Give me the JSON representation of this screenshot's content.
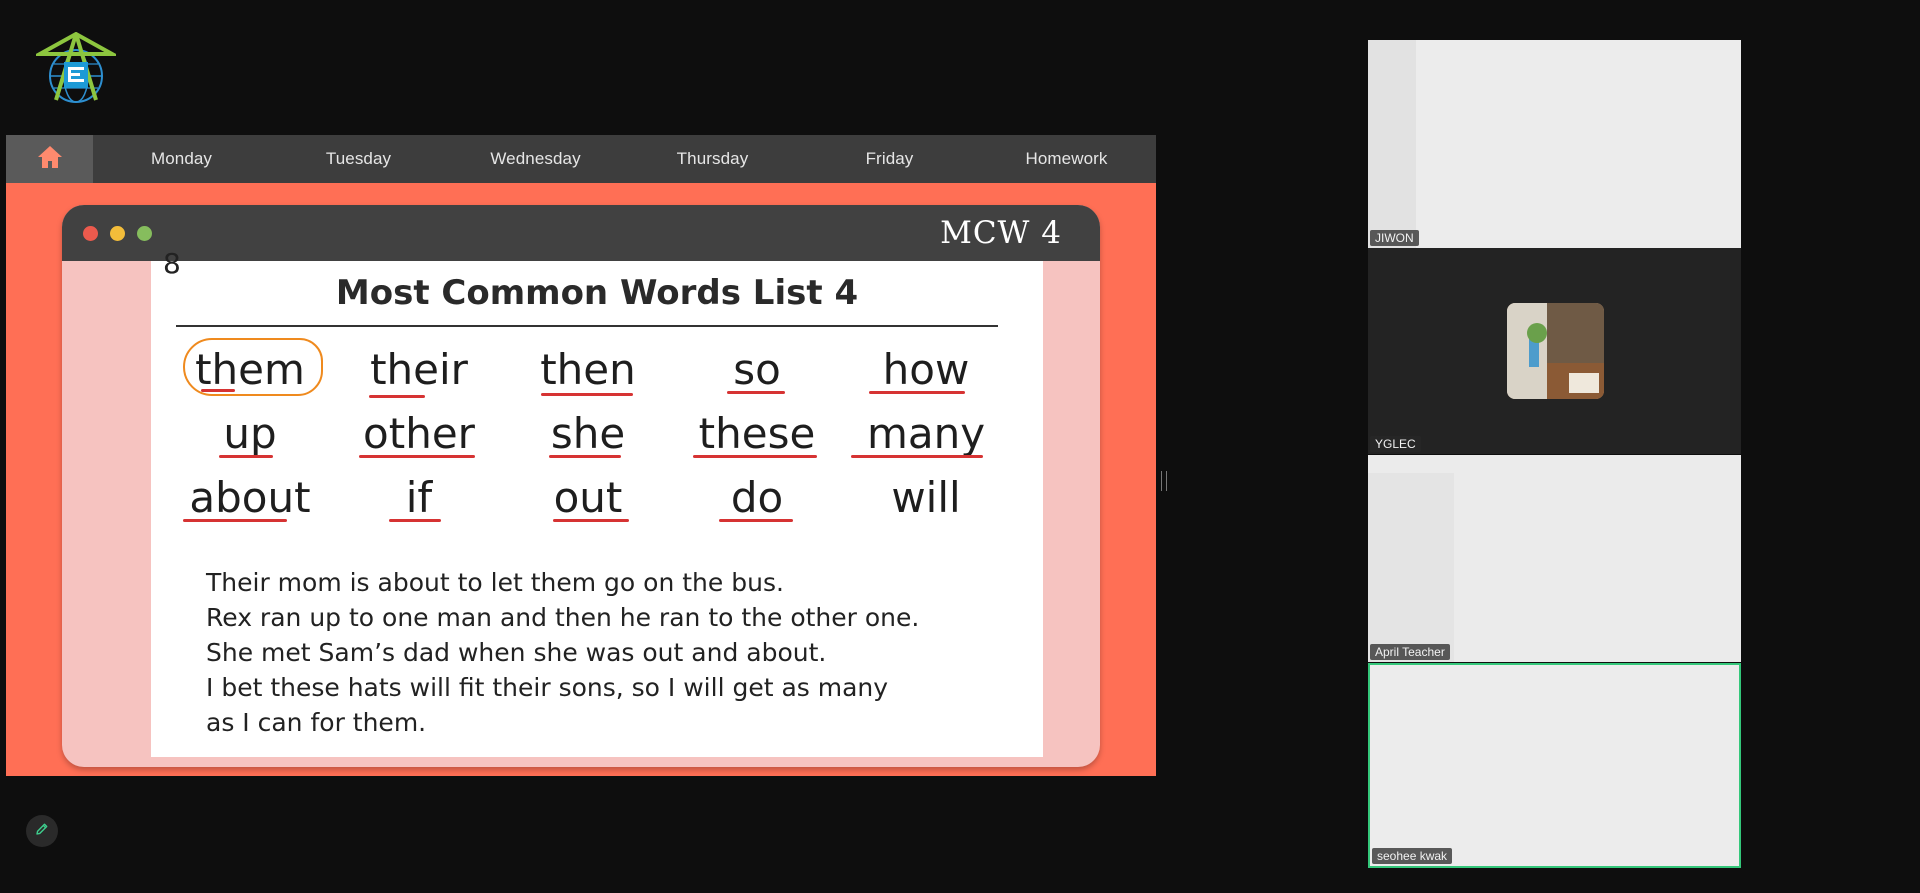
{
  "nav": {
    "items": [
      "Monday",
      "Tuesday",
      "Wednesday",
      "Thursday",
      "Friday",
      "Homework"
    ],
    "home_icon": "home-icon"
  },
  "window": {
    "title": "MCW 4"
  },
  "slide": {
    "corner_glyph": "8",
    "title": "Most Common Words List 4",
    "words": [
      [
        "them",
        "their",
        "then",
        "so",
        "how"
      ],
      [
        "up",
        "other",
        "she",
        "these",
        "many"
      ],
      [
        "about",
        "if",
        "out",
        "do",
        "will"
      ]
    ],
    "sentences": [
      "Their mom is about to let them go on the bus.",
      "Rex ran up to one man and then he ran to the other one.",
      "She met Sam’s dad when she was out and about.",
      "I bet these hats will fit their sons, so I will get as many",
      "as I can for them."
    ]
  },
  "participants": [
    {
      "name": "JIWON"
    },
    {
      "name": "YGLEC"
    },
    {
      "name": "April Teacher"
    },
    {
      "name": "seohee kwak"
    }
  ],
  "colors": {
    "accent_coral": "#ff6f55",
    "active_speaker": "#34c77a"
  }
}
